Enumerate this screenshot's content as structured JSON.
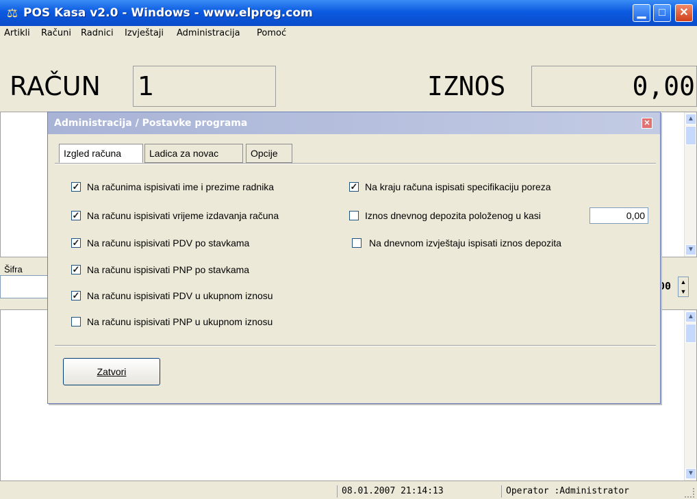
{
  "window": {
    "title": "POS Kasa v2.0 - Windows - www.elprog.com",
    "icon": "cash-register-icon"
  },
  "menu": [
    "Artikli",
    "Računi",
    "Radnici",
    "Izvještaji",
    "Administracija",
    "Pomoć"
  ],
  "header": {
    "racun_label": "RAČUN",
    "racun_value": "1",
    "iznos_label": "IZNOS",
    "iznos_value": "0,00"
  },
  "sifra": {
    "label": "Šifra",
    "qty_fragment": "00"
  },
  "status": {
    "datetime": "08.01.2007 21:14:13",
    "operator": "Operator :Administrator"
  },
  "dialog": {
    "title": "Administracija / Postavke programa",
    "tabs": [
      "Izgled računa",
      "Ladica za novac",
      "Opcije"
    ],
    "active_tab": 0,
    "left_options": [
      {
        "label": "Na računima ispisivati ime i prezime radnika",
        "checked": true
      },
      {
        "label": "Na računu ispisivati vrijeme izdavanja računa",
        "checked": true
      },
      {
        "label": "Na računu ispisivati PDV po stavkama",
        "checked": true
      },
      {
        "label": "Na računu ispisivati PNP po stavkama",
        "checked": true
      },
      {
        "label": "Na računu ispisivati PDV u ukupnom iznosu",
        "checked": true
      },
      {
        "label": "Na računu ispisivati PNP u ukupnom iznosu",
        "checked": false
      }
    ],
    "right_options": [
      {
        "label": "Na kraju računa ispisati specifikaciju poreza",
        "checked": true
      },
      {
        "label": "Iznos dnevnog depozita položenog u kasi",
        "checked": false
      },
      {
        "label": "Na dnevnom izvještaju ispisati iznos depozita",
        "checked": false
      }
    ],
    "deposit_value": "0,00",
    "close_button": "Zatvori"
  }
}
